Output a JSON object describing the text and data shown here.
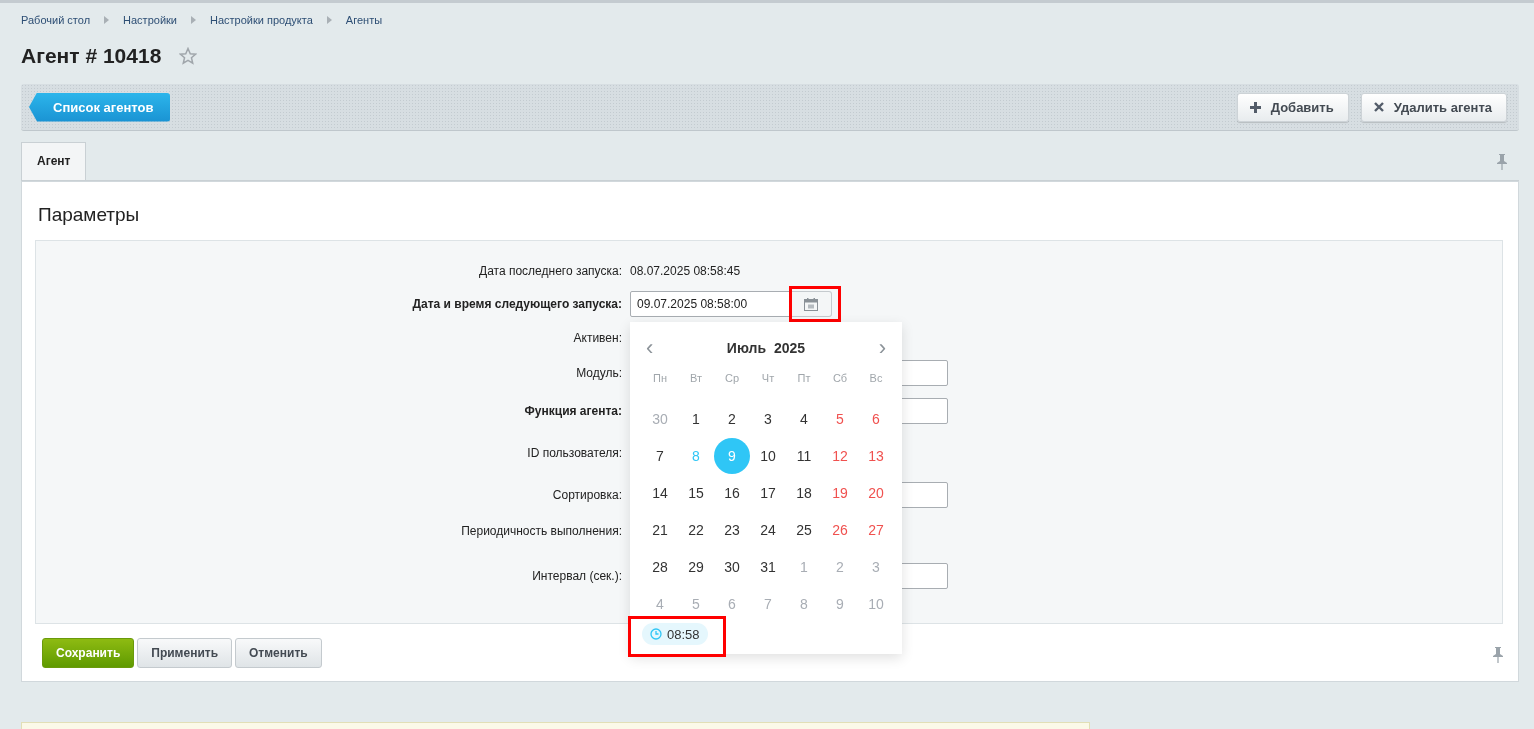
{
  "breadcrumbs": [
    "Рабочий стол",
    "Настройки",
    "Настройки продукта",
    "Агенты"
  ],
  "title": "Агент # 10418",
  "favorite": false,
  "toolbar": {
    "back_button": "Список агентов",
    "buttons": [
      {
        "label": "Добавить"
      },
      {
        "label": "Удалить агента"
      }
    ]
  },
  "tabs": [
    {
      "label": "Агент",
      "selected": true
    }
  ],
  "section_title": "Параметры",
  "fields": [
    {
      "kind": "text",
      "label": "Дата последнего запуска:",
      "required": false,
      "value": "08.07.2025 08:58:45"
    },
    {
      "kind": "date",
      "label": "Дата и время следующего запуска:",
      "required": true,
      "value": "09.07.2025 08:58:00",
      "button_highlighted": true
    },
    {
      "kind": "empty",
      "label": "Активен:",
      "required": false
    },
    {
      "kind": "input",
      "label": "Модуль:",
      "required": false
    },
    {
      "kind": "input",
      "label": "Функция агента:",
      "required": true
    },
    {
      "kind": "empty",
      "label": "ID пользователя:",
      "required": false
    },
    {
      "kind": "input",
      "label": "Сортировка:",
      "required": false
    },
    {
      "kind": "empty",
      "label": "Периодичность выполнения:",
      "required": false
    },
    {
      "kind": "input",
      "label": "Интервал (сек.):",
      "required": false
    }
  ],
  "calendar": {
    "month": "Июль",
    "year": "2025",
    "prev": "‹",
    "next": "›",
    "weekdays": [
      "Пн",
      "Вт",
      "Ср",
      "Чт",
      "Пт",
      "Сб",
      "Вс"
    ],
    "days": [
      {
        "day": "30",
        "kind": "outside",
        "selected": false
      },
      {
        "day": "1",
        "kind": "normal",
        "selected": false
      },
      {
        "day": "2",
        "kind": "normal",
        "selected": false
      },
      {
        "day": "3",
        "kind": "normal",
        "selected": false
      },
      {
        "day": "4",
        "kind": "normal",
        "selected": false
      },
      {
        "day": "5",
        "kind": "weekend",
        "selected": false
      },
      {
        "day": "6",
        "kind": "weekend",
        "selected": false
      },
      {
        "day": "7",
        "kind": "normal",
        "selected": false
      },
      {
        "day": "8",
        "kind": "today",
        "selected": false
      },
      {
        "day": "9",
        "kind": "normal",
        "selected": true
      },
      {
        "day": "10",
        "kind": "normal",
        "selected": false
      },
      {
        "day": "11",
        "kind": "normal",
        "selected": false
      },
      {
        "day": "12",
        "kind": "weekend",
        "selected": false
      },
      {
        "day": "13",
        "kind": "weekend",
        "selected": false
      },
      {
        "day": "14",
        "kind": "normal",
        "selected": false
      },
      {
        "day": "15",
        "kind": "normal",
        "selected": false
      },
      {
        "day": "16",
        "kind": "normal",
        "selected": false
      },
      {
        "day": "17",
        "kind": "normal",
        "selected": false
      },
      {
        "day": "18",
        "kind": "normal",
        "selected": false
      },
      {
        "day": "19",
        "kind": "weekend",
        "selected": false
      },
      {
        "day": "20",
        "kind": "weekend",
        "selected": false
      },
      {
        "day": "21",
        "kind": "normal",
        "selected": false
      },
      {
        "day": "22",
        "kind": "normal",
        "selected": false
      },
      {
        "day": "23",
        "kind": "normal",
        "selected": false
      },
      {
        "day": "24",
        "kind": "normal",
        "selected": false
      },
      {
        "day": "25",
        "kind": "normal",
        "selected": false
      },
      {
        "day": "26",
        "kind": "weekend",
        "selected": false
      },
      {
        "day": "27",
        "kind": "weekend",
        "selected": false
      },
      {
        "day": "28",
        "kind": "normal",
        "selected": false
      },
      {
        "day": "29",
        "kind": "normal",
        "selected": false
      },
      {
        "day": "30",
        "kind": "normal",
        "selected": false
      },
      {
        "day": "31",
        "kind": "normal",
        "selected": false
      },
      {
        "day": "1",
        "kind": "outside",
        "selected": false
      },
      {
        "day": "2",
        "kind": "outside",
        "selected": false
      },
      {
        "day": "3",
        "kind": "outside",
        "selected": false
      },
      {
        "day": "4",
        "kind": "outside",
        "selected": false
      },
      {
        "day": "5",
        "kind": "outside",
        "selected": false
      },
      {
        "day": "6",
        "kind": "outside",
        "selected": false
      },
      {
        "day": "7",
        "kind": "outside",
        "selected": false
      },
      {
        "day": "8",
        "kind": "outside",
        "selected": false
      },
      {
        "day": "9",
        "kind": "outside",
        "selected": false
      },
      {
        "day": "10",
        "kind": "outside",
        "selected": false
      }
    ],
    "time": "08:58",
    "time_highlighted": true
  },
  "actions": [
    {
      "label": "Сохранить",
      "kind": "primary"
    },
    {
      "label": "Применить",
      "kind": "normal"
    },
    {
      "label": "Отменить",
      "kind": "normal"
    }
  ]
}
